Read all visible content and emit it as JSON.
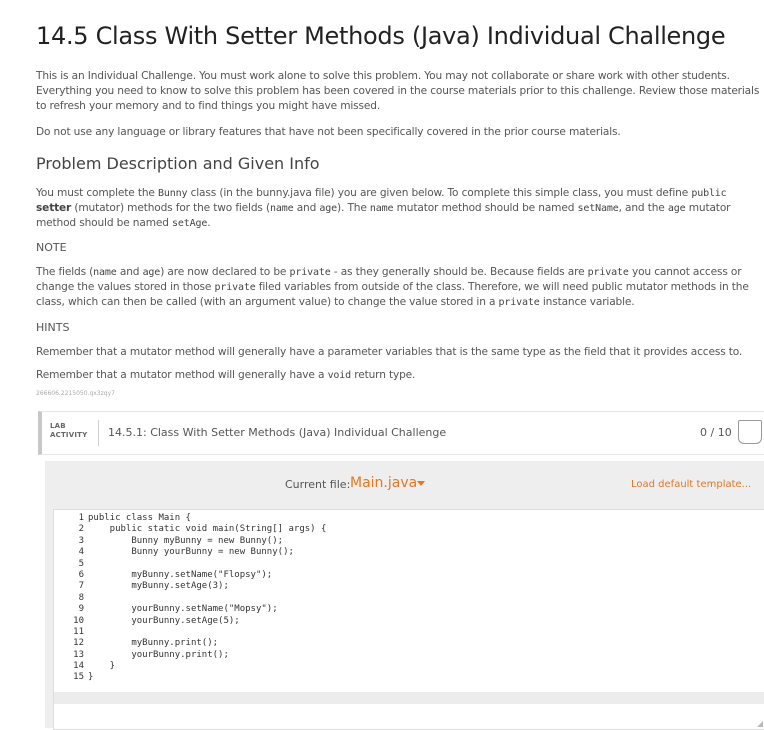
{
  "title": "14.5 Class With Setter Methods (Java) Individual Challenge",
  "intro": {
    "p1": "This is an Individual Challenge. You must work alone to solve this problem. You may not collaborate or share work with other students. Everything you need to know to solve this problem has been covered in the course materials prior to this challenge. Review those materials to refresh your memory and to find things you might have missed.",
    "p2": "Do not use any language or library features that have not been specifically covered in the prior course materials."
  },
  "section_heading": "Problem Description and Given Info",
  "desc": {
    "t1": "You must complete the ",
    "c1": "Bunny",
    "t2": " class (in the bunny.java file) you are given below. To complete this simple class, you must define ",
    "c2": "public",
    "t3": " setter",
    "t4": " (mutator) methods for the two fields (",
    "c3": "name",
    "t5": " and ",
    "c4": "age",
    "t6": "). The ",
    "c5": "name",
    "t7": " mutator method should be named ",
    "c6": "setName",
    "t8": ", and the ",
    "c7": "age",
    "t9": " mutator method should be named ",
    "c8": "setAge",
    "t10": "."
  },
  "note_label": "NOTE",
  "note": {
    "t1": "The fields (",
    "c1": "name",
    "t2": " and ",
    "c2": "age",
    "t3": ") are now declared to be ",
    "c3": "private",
    "t4": " - as they generally should be. Because fields are ",
    "c4": "private",
    "t5": " you cannot access or change the values stored in those ",
    "c5": "private",
    "t6": " filed variables from outside of the class. Therefore, we will need public mutator methods in the class, which can then be called (with an argument value) to change the value stored in a ",
    "c6": "private",
    "t7": " instance variable."
  },
  "hints_label": "HINTS",
  "hint1": "Remember that a mutator method will generally have a parameter variables that is the same type as the field that it provides access to.",
  "hint2": {
    "t1": "Remember that a mutator method will generally have a ",
    "c1": "void",
    "t2": " return type."
  },
  "tiny_id": "266606.2215050.qx3zqy7",
  "lab": {
    "tag_line1": "LAB",
    "tag_line2": "ACTIVITY",
    "title": "14.5.1: Class With Setter Methods (Java) Individual Challenge",
    "score": "0 / 10"
  },
  "workspace": {
    "current_file_label": "Current file:",
    "current_file": "Main.java",
    "load_template": "Load default template..."
  },
  "code_lines": [
    "public class Main {",
    "    public static void main(String[] args) {",
    "        Bunny myBunny = new Bunny();",
    "        Bunny yourBunny = new Bunny();",
    "",
    "        myBunny.setName(\"Flopsy\");",
    "        myBunny.setAge(3);",
    "",
    "        yourBunny.setName(\"Mopsy\");",
    "        yourBunny.setAge(5);",
    "",
    "        myBunny.print();",
    "        yourBunny.print();",
    "    }",
    "}"
  ],
  "line_numbers": [
    "1",
    "2",
    "3",
    "4",
    "5",
    "6",
    "7",
    "8",
    "9",
    "10",
    "11",
    "12",
    "13",
    "14",
    "15"
  ]
}
